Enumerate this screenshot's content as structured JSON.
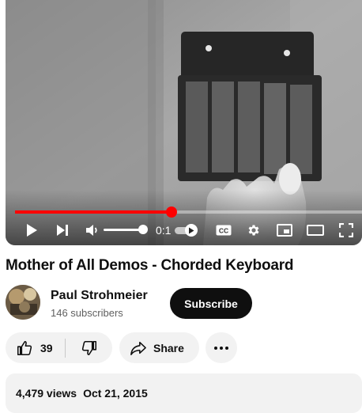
{
  "player": {
    "progress_percent": 45,
    "time_label": "0:1",
    "volume_percent": 88,
    "autoplay_on": true
  },
  "video": {
    "title": "Mother of All Demos - Chorded Keyboard"
  },
  "channel": {
    "name": "Paul Strohmeier",
    "subscribers": "146 subscribers",
    "subscribe_label": "Subscribe"
  },
  "actions": {
    "like_count": "39",
    "share_label": "Share"
  },
  "description": {
    "views": "4,479 views",
    "date": "Oct 21, 2015"
  },
  "colors": {
    "accent_red": "#ff0000",
    "button_dark": "#0f0f0f",
    "pill_bg": "#f2f2f2"
  },
  "icons": [
    "play-icon",
    "next-icon",
    "volume-icon",
    "autoplay-toggle",
    "captions-icon",
    "settings-icon",
    "miniplayer-icon",
    "theater-icon",
    "fullscreen-icon",
    "like-icon",
    "dislike-icon",
    "share-icon",
    "more-icon"
  ]
}
